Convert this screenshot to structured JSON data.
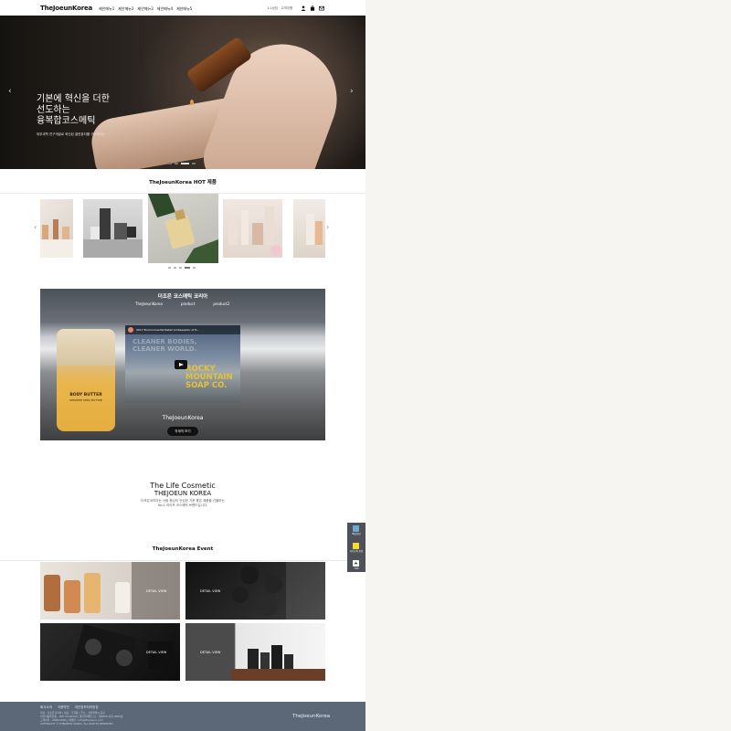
{
  "header": {
    "logo": "TheJoeunKorea",
    "menu": [
      "제안메뉴1",
      "제안메뉴2",
      "제안메뉴3",
      "제안메뉴4",
      "제안메뉴5"
    ],
    "util_text": "1:1상담 · 고객지원",
    "icons": [
      "user-icon",
      "bag-icon",
      "mail-icon"
    ]
  },
  "hero": {
    "title_line1": "기본에 혁신을 더한",
    "title_line2": "선도하는",
    "title_line3": "융복합코스메틱",
    "subtitle": "피부과학 연구개발로 혁신된 클린뷰티를 구도해내는"
  },
  "products": {
    "section_title": "TheJoeunKorea HOT 제품"
  },
  "video": {
    "title": "더조은 코스메틱 코리아",
    "tabs": [
      "TheJoeunKorea",
      "product",
      "product2"
    ],
    "yt_title": "2017 Environmental Retail Ambassador of R...",
    "tube_label1": "BODY BUTTER",
    "tube_label2": "WHIPPED SHEA BUTTER",
    "big_text1": "CLEANER BODIES,",
    "big_text2": "CLEANER WORLD.",
    "big_text3": "ROCKY",
    "big_text4": "MOUNTAIN",
    "big_text5": "SOAP CO.",
    "brand": "TheJoeunKorea",
    "button": "자세히 보기"
  },
  "life": {
    "line1": "The Life Cosmetic",
    "line2": "THEJOEUN KOREA",
    "desc1": "더조은코리아는 사람 중심의 안심한 기준 좋은 제품을 선물하는",
    "desc2": "No.1 라이프 코스메틱 브랜드입니다."
  },
  "events": {
    "section_title": "TheJoeunKorea Event",
    "items": [
      {
        "label": "DETAIL VIEW"
      },
      {
        "label": "DETAIL VIEW"
      },
      {
        "label": "DETAIL VIEW"
      },
      {
        "label": "DETAIL VIEW"
      }
    ]
  },
  "quick": [
    "빠른상담",
    "카카오톡 상담",
    "TOP"
  ],
  "footer": {
    "links": [
      "회사소개",
      "이용약관",
      "개인정보처리방침"
    ],
    "info1": "회사 : 더조은코리아 | 대표 : 홍길동 | 주소 : 서울특별시 중구",
    "info2": "사업자등록번호 : 000-00-00000 | 통신판매업신고 : 제0000-서울-0000호",
    "info3": "고객센터 : 0000-0000 | 이메일 : info@thejoeun.com",
    "copyright": "COPYRIGHT © THEJOEUN KOREA. ALL RIGHTS RESERVED.",
    "brand": "TheJoeunKorea"
  }
}
